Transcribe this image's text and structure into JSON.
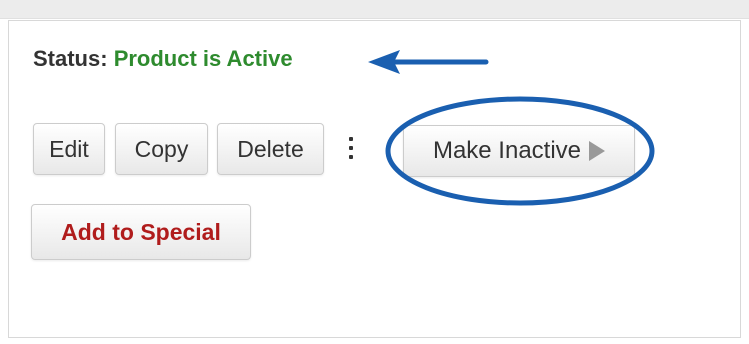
{
  "status": {
    "label": "Status:",
    "value": "Product is Active"
  },
  "toolbar": {
    "edit_label": "Edit",
    "copy_label": "Copy",
    "delete_label": "Delete",
    "more_icon": "kebab-menu-icon",
    "make_inactive_label": "Make Inactive",
    "make_inactive_icon": "play-icon",
    "add_to_special_label": "Add to Special"
  },
  "annotations": {
    "arrow_color": "#1a5fb0",
    "circle_color": "#1a5fb0"
  },
  "colors": {
    "status_active": "#2e8b2e",
    "special_text": "#b01c1c"
  }
}
